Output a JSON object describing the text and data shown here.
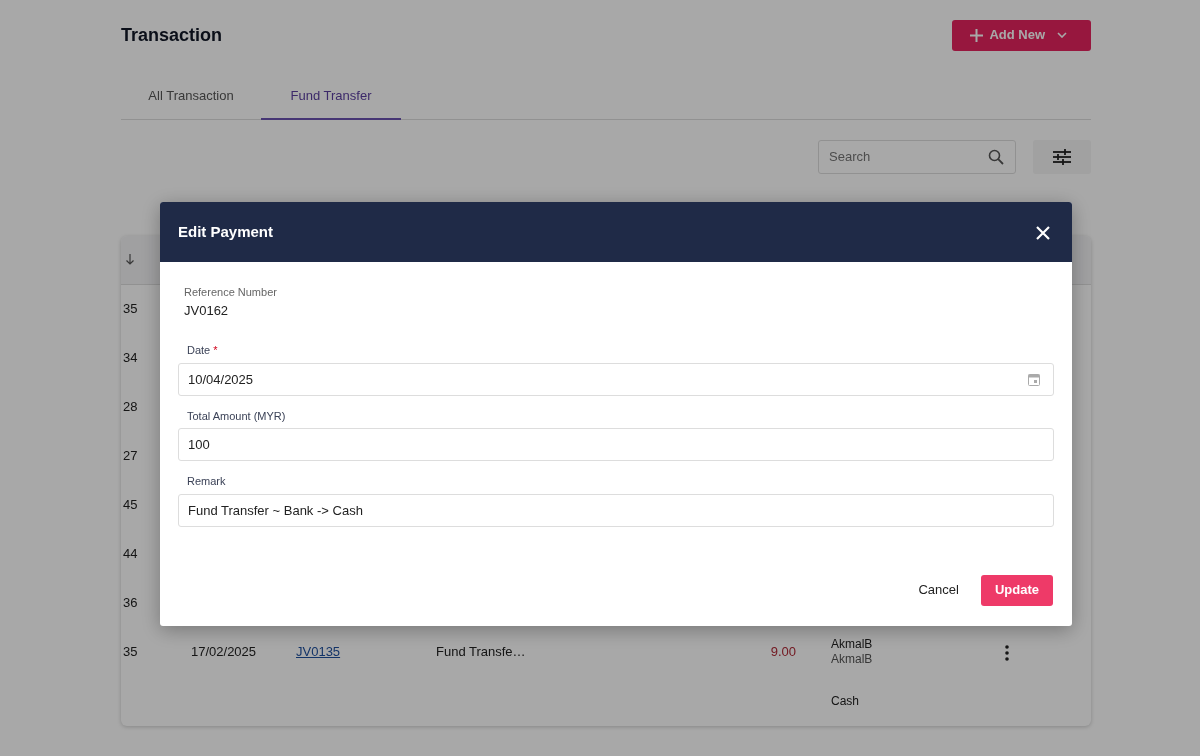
{
  "page": {
    "title": "Transaction",
    "add_button": "Add New",
    "tabs": [
      {
        "label": "All Transaction",
        "selected": false
      },
      {
        "label": "Fund Transfer",
        "selected": true
      }
    ],
    "search": {
      "placeholder": "Search"
    }
  },
  "table": {
    "rows": [
      {
        "id": "35"
      },
      {
        "id": "34"
      },
      {
        "id": "28"
      },
      {
        "id": "27"
      },
      {
        "id": "45"
      },
      {
        "id": "44"
      },
      {
        "id": "36"
      },
      {
        "id": "35",
        "date": "17/02/2025",
        "ref": "JV0135",
        "description": "Fund Transfe…",
        "amount": "9.00",
        "user": [
          "AkmalB",
          "AkmalB"
        ],
        "menu": true
      },
      {
        "user": [
          "Cash"
        ]
      }
    ]
  },
  "modal": {
    "title": "Edit Payment",
    "fields": [
      {
        "kind": "static",
        "label": "Reference Number",
        "value": "JV0162"
      },
      {
        "kind": "date",
        "label": "Date",
        "required_mark": "*",
        "value": "10/04/2025"
      },
      {
        "kind": "text",
        "label": "Total Amount (MYR)",
        "value": "100"
      },
      {
        "kind": "text",
        "label": "Remark",
        "value": "Fund Transfer ~ Bank -> Cash"
      }
    ],
    "buttons": [
      {
        "kind": "link",
        "label": "Cancel"
      },
      {
        "kind": "primary",
        "label": "Update"
      }
    ]
  }
}
